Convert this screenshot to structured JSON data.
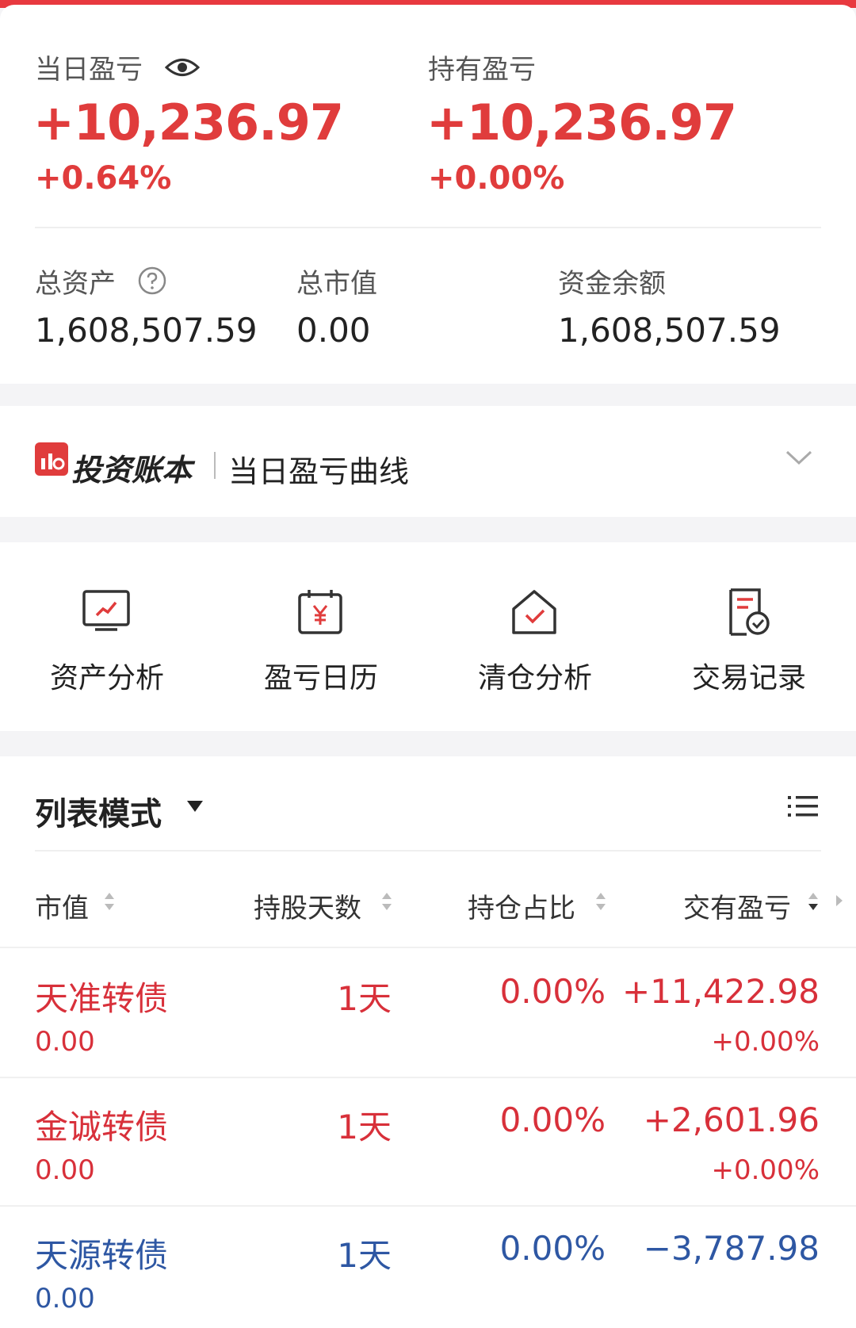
{
  "summary": {
    "daily_pl_label": "当日盈亏",
    "daily_pl_value": "+10,236.97",
    "daily_pl_pct": "+0.64%",
    "holding_pl_label": "持有盈亏",
    "holding_pl_value": "+10,236.97",
    "holding_pl_pct": "+0.00%",
    "total_assets_label": "总资产",
    "total_assets_value": "1,608,507.59",
    "market_value_label": "总市值",
    "market_value_value": "0.00",
    "cash_balance_label": "资金余额",
    "cash_balance_value": "1,608,507.59"
  },
  "ledger": {
    "brand": "投资账本",
    "title": "当日盈亏曲线"
  },
  "tools": [
    {
      "label": "资产分析",
      "icon": "chart-monitor-icon"
    },
    {
      "label": "盈亏日历",
      "icon": "yen-calendar-icon"
    },
    {
      "label": "清仓分析",
      "icon": "house-check-icon"
    },
    {
      "label": "交易记录",
      "icon": "document-check-icon"
    }
  ],
  "list": {
    "mode_label": "列表模式",
    "columns": [
      "市值",
      "持股天数",
      "持仓占比",
      "交有盈亏"
    ],
    "rows": [
      {
        "name": "天准转债",
        "market_value": "0.00",
        "days": "1天",
        "ratio": "0.00%",
        "pl": "+11,422.98",
        "pl_pct": "+0.00%",
        "color": "#d8303a"
      },
      {
        "name": "金诚转债",
        "market_value": "0.00",
        "days": "1天",
        "ratio": "0.00%",
        "pl": "+2,601.96",
        "pl_pct": "+0.00%",
        "color": "#d8303a"
      },
      {
        "name": "天源转债",
        "market_value": "0.00",
        "days": "1天",
        "ratio": "0.00%",
        "pl": "−3,787.98",
        "pl_pct": "",
        "color": "#2e57a3"
      }
    ]
  }
}
